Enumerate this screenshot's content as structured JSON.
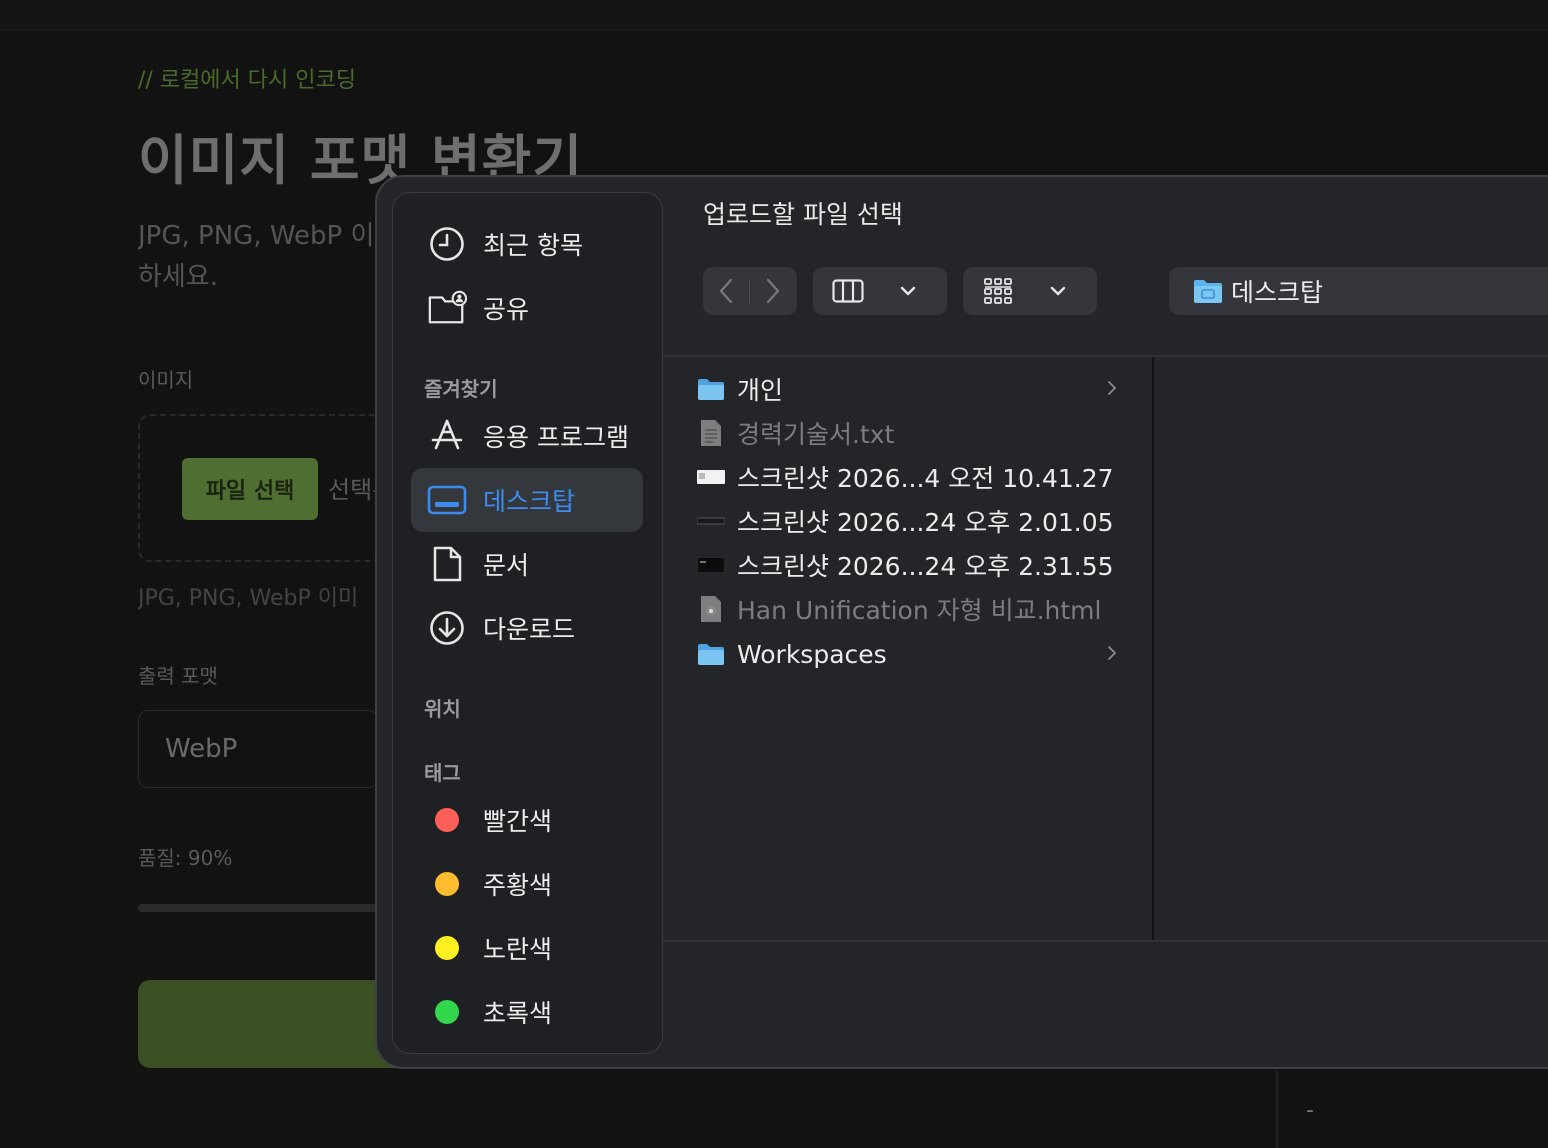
{
  "background_page": {
    "comment": "// 로컬에서 다시 인코딩",
    "title": "이미지 포맷 변환기",
    "description_line1": "JPG, PNG, WebP 이",
    "description_line2": "하세요.",
    "image_label": "이미지",
    "file_button_label": "파일 선택",
    "file_status_text": "선택된",
    "hint_text": "JPG, PNG, WebP 이미",
    "output_format_label": "출력 포맷",
    "output_format_value": "WebP",
    "quality_label": "품질: 90%",
    "quality_value": 90,
    "side_panel_value": "-"
  },
  "dialog": {
    "title": "업로드할 파일 선택",
    "location": "데스크탑",
    "sidebar": {
      "items": [
        {
          "label": "최근 항목",
          "icon": "clock-icon"
        },
        {
          "label": "공유",
          "icon": "shared-folder-icon"
        }
      ],
      "favorites_header": "즐겨찾기",
      "favorites": [
        {
          "label": "응용 프로그램",
          "icon": "applications-icon"
        },
        {
          "label": "데스크탑",
          "icon": "desktop-icon",
          "selected": true
        },
        {
          "label": "문서",
          "icon": "document-icon"
        },
        {
          "label": "다운로드",
          "icon": "download-icon"
        }
      ],
      "locations_header": "위치",
      "tags_header": "태그",
      "tags": [
        {
          "label": "빨간색",
          "color": "#ff5f57"
        },
        {
          "label": "주황색",
          "color": "#febc2e"
        },
        {
          "label": "노란색",
          "color": "#fff01f"
        },
        {
          "label": "초록색",
          "color": "#32d74b"
        }
      ]
    },
    "files": [
      {
        "name": "개인",
        "kind": "folder",
        "has_children": true,
        "dimmed": false
      },
      {
        "name": "경력기술서.txt",
        "kind": "text",
        "has_children": false,
        "dimmed": true
      },
      {
        "name": "스크린샷 2026...4 오전 10.41.27",
        "kind": "image",
        "has_children": false,
        "dimmed": false
      },
      {
        "name": "스크린샷 2026...24 오후 2.01.05",
        "kind": "image-dark",
        "has_children": false,
        "dimmed": false
      },
      {
        "name": "스크린샷 2026...24 오후 2.31.55",
        "kind": "image-dark",
        "has_children": false,
        "dimmed": false
      },
      {
        "name": "Han Unification 자형 비교.html",
        "kind": "html",
        "has_children": false,
        "dimmed": true
      },
      {
        "name": "Workspaces",
        "kind": "folder",
        "has_children": true,
        "dimmed": false
      }
    ]
  }
}
